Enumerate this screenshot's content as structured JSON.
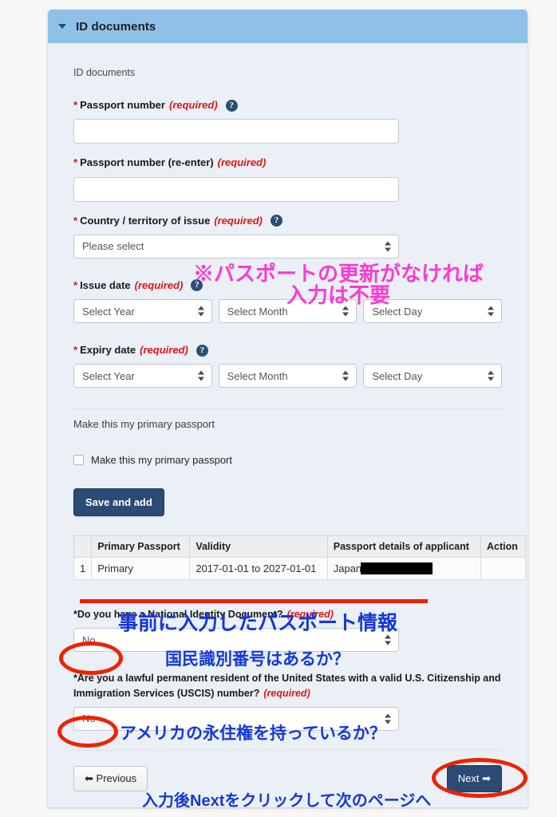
{
  "panel": {
    "title": "ID documents",
    "caret_icon": "chevron-down-icon",
    "section_label": "ID documents"
  },
  "fields": {
    "passport_number": {
      "label": "Passport number",
      "required_text": "(required)",
      "has_help": true,
      "value": ""
    },
    "passport_number_reenter": {
      "label": "Passport number (re-enter)",
      "required_text": "(required)",
      "has_help": false,
      "value": ""
    },
    "country_of_issue": {
      "label": "Country / territory of issue",
      "required_text": "(required)",
      "has_help": true,
      "value": "Please select"
    },
    "issue_date": {
      "label": "Issue date",
      "required_text": "(required)",
      "has_help": true,
      "year": "Select Year",
      "month": "Select Month",
      "day": "Select Day"
    },
    "expiry_date": {
      "label": "Expiry date",
      "required_text": "(required)",
      "has_help": true,
      "year": "Select Year",
      "month": "Select Month",
      "day": "Select Day"
    },
    "primary_passport_heading": "Make this my primary passport",
    "primary_passport_checkbox_label": "Make this my primary passport",
    "save_and_add_label": "Save and add"
  },
  "table": {
    "headers": [
      "",
      "Primary Passport",
      "Validity",
      "Passport details of applicant",
      "Action"
    ],
    "rows": [
      {
        "index": "1",
        "primary_passport": "Primary",
        "validity": "2017-01-01 to 2027-01-01",
        "details": "Japan",
        "details_redacted": true,
        "action": ""
      }
    ]
  },
  "questions": [
    {
      "label": "Do you have a National Identity Document?",
      "required_text": "(required)",
      "value": "No"
    },
    {
      "label": "Are you a lawful permanent resident of the United States with a valid U.S. Citizenship and Immigration Services (USCIS) number?",
      "required_text": "(required)",
      "value": "No"
    }
  ],
  "nav": {
    "previous_label": "Previous",
    "previous_icon": "arrow-left-icon",
    "next_label": "Next",
    "next_icon": "arrow-right-icon"
  },
  "annotations": {
    "pink_note_line1": "※パスポートの更新がなければ",
    "pink_note_line2": "入力は不要",
    "blue_note_table": "事前に入力したパスポート情報",
    "blue_note_national_id": "国民識別番号はあるか？",
    "blue_note_green_card": "アメリカの永住権を持っているか？",
    "blue_note_next": "入力後Nextをクリックして次のページへ"
  },
  "colors": {
    "panel_header": "#8fc0e8",
    "panel_body": "#eaf0f5",
    "navy_button": "#2b4a74",
    "required_red": "#e11414",
    "annotation_pink": "#fb3bd0",
    "annotation_blue": "#1538d8",
    "annotation_circle_red": "#ee2200"
  }
}
